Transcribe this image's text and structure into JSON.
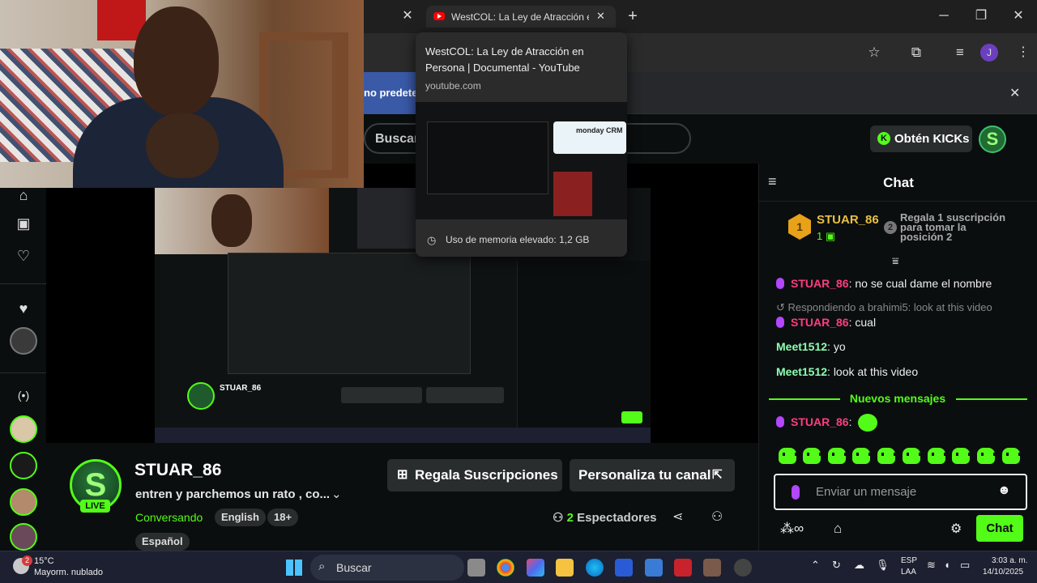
{
  "browser": {
    "active_tab_title": "WestCOL: La Ley de Atracción en P",
    "new_tab_symbol": "+",
    "close_symbol": "✕",
    "infobar_text": "no predeterm"
  },
  "tab_preview": {
    "title": "WestCOL: La Ley de Atracción en Persona | Documental - YouTube",
    "url": "youtube.com",
    "memory_text": "Uso de memoria elevado: 1,2 GB",
    "thumb_ad": "monday CRM"
  },
  "site": {
    "search_placeholder": "Buscar",
    "kicks_label": "Obtén KICKs",
    "kicks_icon": "K",
    "user_avatar": "S"
  },
  "stream": {
    "name": "STUAR_86",
    "title": "entren y parchemos un rato , co...",
    "category": "Conversando",
    "tags": [
      "English",
      "18+",
      "Español"
    ],
    "live": "LIVE",
    "avatar_letter": "S",
    "gift_button": "Regala Suscripciones",
    "customize_button": "Personaliza tu canal",
    "viewers_count": "2",
    "viewers_label": "Espectadores"
  },
  "chat": {
    "title": "Chat",
    "top_gifter": "STUAR_86",
    "top_gifter_count": "1",
    "rank1": "1",
    "rank2": "2",
    "gift_prompt": "Regala 1 suscripción para tomar la posición 2",
    "messages": [
      {
        "user": "STUAR_86",
        "text": ": no se cual dame el nombre"
      },
      {
        "reply": "Respondiendo a brahimi5: look at this video"
      },
      {
        "user": "STUAR_86",
        "text": ": cual"
      },
      {
        "user": "Meet1512",
        "text": ": yo"
      },
      {
        "user": "Meet1512",
        "text": ": look at this video"
      }
    ],
    "new_messages": "Nuevos mensajes",
    "last_user": "STUAR_86",
    "last_text": ":",
    "input_placeholder": "Enviar un mensaje",
    "send_label": "Chat"
  },
  "taskbar": {
    "weather_temp": "15°C",
    "weather_desc": "Mayorm. nublado",
    "weather_badge": "2",
    "search": "Buscar",
    "lang1": "ESP",
    "lang2": "LAA",
    "time": "3:03 a. m.",
    "date": "14/10/2025"
  },
  "colors": {
    "kick_green": "#53fc18",
    "username_pink": "#ff3c7e",
    "username_green": "#8dffb2",
    "mic_purple": "#b346ff"
  }
}
